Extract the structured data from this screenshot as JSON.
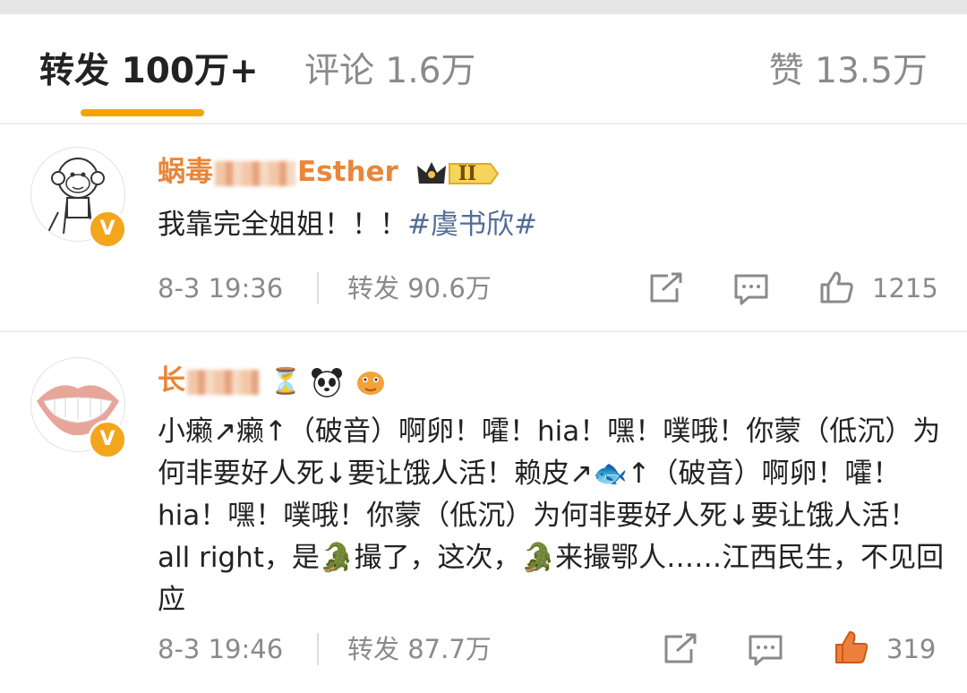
{
  "tabs": {
    "repost": "转发 100万+",
    "comment": "评论 1.6万",
    "like": "赞 13.5万"
  },
  "comments": [
    {
      "username_prefix": "蜗毒",
      "username_suffix": "Esther",
      "vip_level": "II",
      "text": "我靠完全姐姐！！！",
      "hashtag": "#虞书欣#",
      "time": "8-3 19:36",
      "repost": "转发 90.6万",
      "likes": "1215"
    },
    {
      "username_prefix": "长",
      "username_suffix": "",
      "text": "小癞↗癞↑（破音）啊卵！嚯！hia！嘿！噗哦！你蒙（低沉）为何非要好人死↓要让饿人活！赖皮↗🐟↑（破音）啊卵！嚯！hia！嘿！噗哦！你蒙（低沉）为何非要好人死↓要让饿人活！all right，是🐊撮了，这次，🐊来撮鄂人……江西民生，不见回应",
      "time": "8-3 19:46",
      "repost": "转发 87.7万",
      "likes": "319"
    }
  ],
  "colors": {
    "accent": "#f0a500",
    "username": "#e8863a",
    "hashtag": "#526c98",
    "muted": "#8a8a8a",
    "liked": "#ef7f3a"
  }
}
